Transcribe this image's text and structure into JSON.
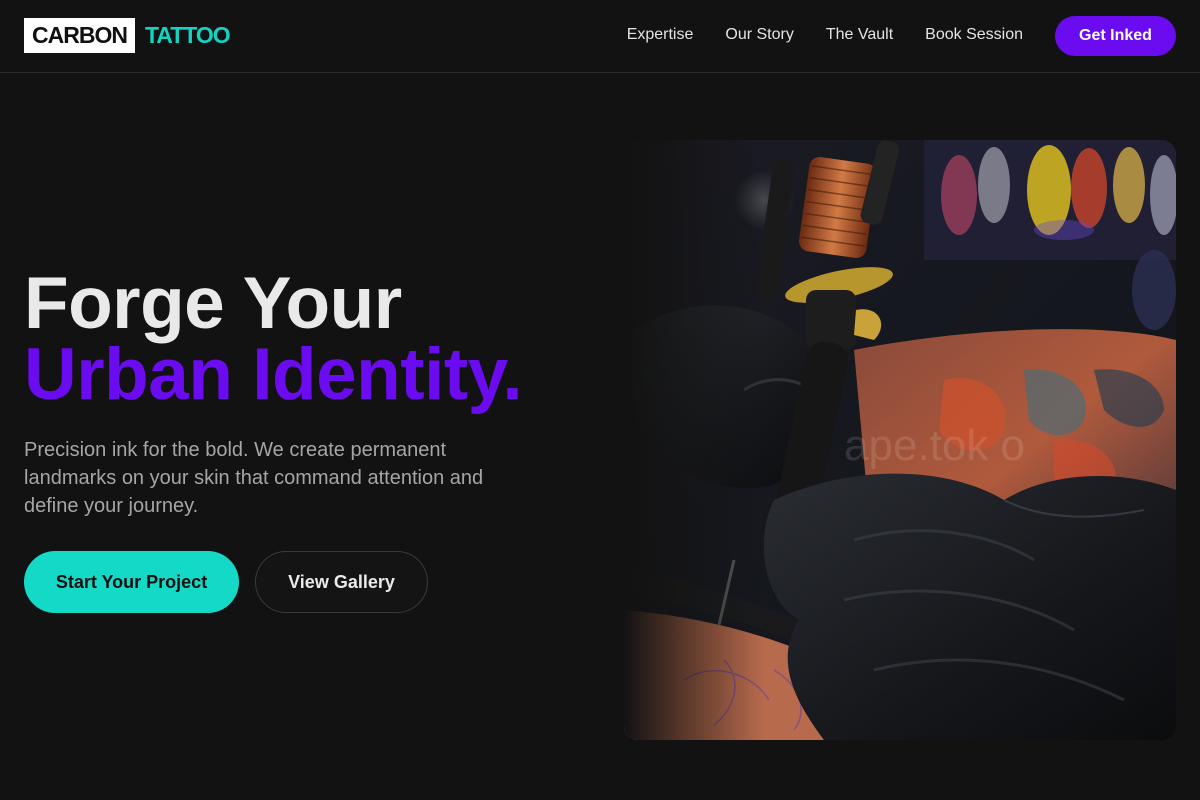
{
  "header": {
    "logo_main": "CARBON",
    "logo_accent": "TATTOO",
    "nav": [
      "Expertise",
      "Our Story",
      "The Vault",
      "Book Session"
    ],
    "cta": "Get Inked"
  },
  "hero": {
    "title_line_1": "Forge Your",
    "title_line_2": "Urban Identity.",
    "lead": "Precision ink for the bold. We create permanent landmarks on your skin that command attention and define your journey.",
    "primary_button": "Start Your Project",
    "secondary_button": "View Gallery",
    "image": {
      "subject": "tattoo artist in black gloves holding a tattoo machine over a tattooed arm"
    }
  },
  "colors": {
    "background": "#121212",
    "purple_accent": "#6a0bf0",
    "teal_accent": "#14d9c6"
  }
}
